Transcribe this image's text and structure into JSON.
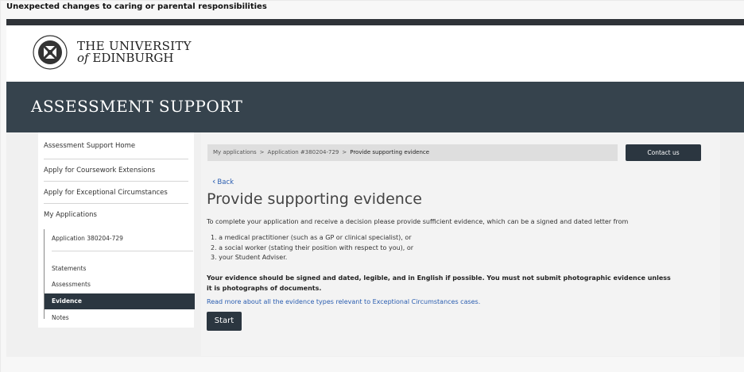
{
  "slide": {
    "title": "Unexpected changes to caring or parental responsibilities"
  },
  "header": {
    "uni_line1": "THE UNIVERSITY",
    "uni_of": "of",
    "uni_line2": "EDINBURGH",
    "banner_title": "ASSESSMENT SUPPORT"
  },
  "sidebar": {
    "items": [
      {
        "label": "Assessment Support Home"
      },
      {
        "label": "Apply for Coursework Extensions"
      },
      {
        "label": "Apply for Exceptional Circumstances"
      },
      {
        "label": "My Applications"
      }
    ],
    "application_label": "Application 380204-729",
    "sub_items": [
      {
        "label": "Statements"
      },
      {
        "label": "Assessments"
      },
      {
        "label": "Evidence"
      },
      {
        "label": "Notes"
      }
    ]
  },
  "breadcrumb": {
    "items": [
      "My applications",
      "Application #380204-729",
      "Provide supporting evidence"
    ],
    "separator": ">"
  },
  "contact_button": "Contact us",
  "back_link": "Back",
  "page_title": "Provide supporting evidence",
  "intro": "To complete your application and receive a decision please provide sufficient evidence, which can be a signed and dated letter from",
  "evidence_list": [
    "1. a medical practitioner (such as a GP or clinical specialist), or",
    "2. a social worker (stating their position with respect to you), or",
    "3. your Student Adviser."
  ],
  "warning": "Your evidence should be signed and dated, legible, and in English if possible. You must not submit photographic evidence unless it is photographs of documents.",
  "read_more": "Read more about all the evidence types relevant to Exceptional Circumstances cases.",
  "start_button": "Start",
  "colors": {
    "dark": "#2b3640",
    "banner": "#36434d",
    "link": "#2a5db0"
  }
}
